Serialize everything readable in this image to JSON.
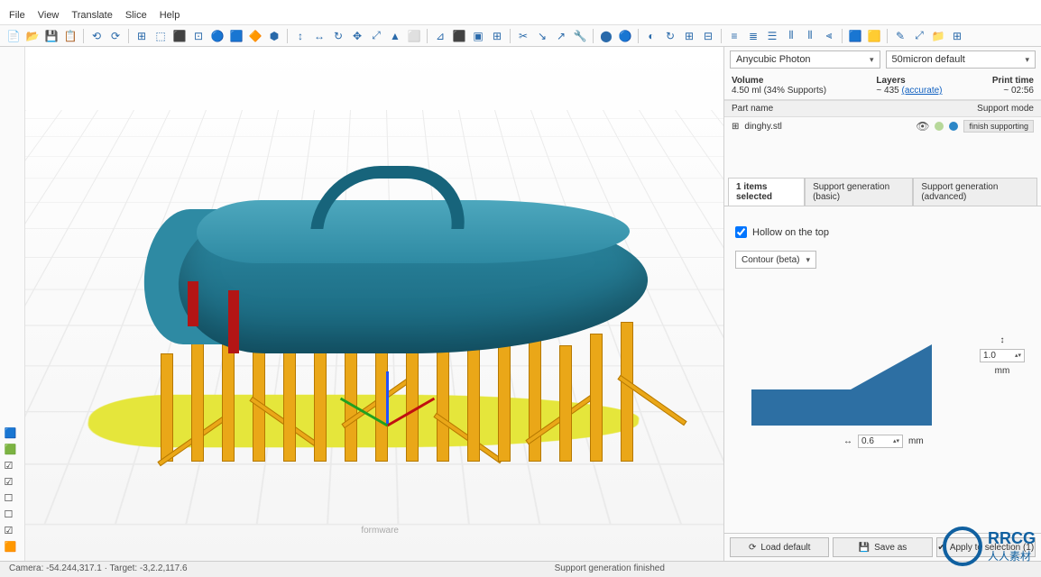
{
  "menu": {
    "file": "File",
    "view": "View",
    "translate": "Translate",
    "slice": "Slice",
    "help": "Help"
  },
  "toolbar_icons": [
    "📄",
    "📂",
    "💾",
    "📋",
    "|",
    "⟲",
    "⟳",
    "|",
    "⊞",
    "⬚",
    "⬛",
    "⊡",
    "🔵",
    "🟦",
    "🔶",
    "⬢",
    "|",
    "↕",
    "↔",
    "↻",
    "✥",
    "⤢",
    "▲",
    "⬜",
    "|",
    "⊿",
    "⬛",
    "▣",
    "⊞",
    "|",
    "✂",
    "↘",
    "↗",
    "🔧",
    "|",
    "⬤",
    "🔵",
    "|",
    "◐",
    "↻",
    "⊞",
    "⊟",
    "|",
    "≡",
    "≣",
    "☰",
    "⫴",
    "⫴",
    "⫷",
    "|",
    "🟦",
    "🟨",
    "|",
    "✎",
    "⤢",
    "📁",
    "⊞"
  ],
  "left_strip": [
    "🟦",
    "🟩",
    "☑",
    "☑",
    "☐",
    "☐",
    "☑",
    "🟧"
  ],
  "printer_select": "Anycubic Photon",
  "profile_select": "50micron default",
  "info": {
    "volume_hdr": "Volume",
    "volume_val": "4.50 ml (34% Supports)",
    "layers_hdr": "Layers",
    "layers_val": "~ 435",
    "layers_link": "(accurate)",
    "time_hdr": "Print time",
    "time_val": "~ 02:56"
  },
  "part": {
    "hdr_name": "Part name",
    "hdr_mode": "Support mode",
    "filename": "dinghy.stl",
    "expand": "⊞",
    "mode": "finish supporting"
  },
  "tabs": {
    "sel": "1 items selected",
    "basic": "Support generation (basic)",
    "adv": "Support generation (advanced)"
  },
  "params": {
    "hollow": "Hollow on the top",
    "contour": "Contour (beta)",
    "height_val": "1.0",
    "width_val": "0.6",
    "mm": "mm"
  },
  "btns": {
    "load": "Load default",
    "save": "Save as",
    "apply": "Apply to selection (1)",
    "load_icon": "⟳",
    "save_icon": "💾",
    "apply_icon": "✔"
  },
  "status": {
    "left": "Camera: -54.244,317.1 · Target: -3,2.2,117.6",
    "center": "Support generation finished"
  },
  "watermark": "formware",
  "logo_text": "RRCG",
  "logo_sub": "人人素材"
}
